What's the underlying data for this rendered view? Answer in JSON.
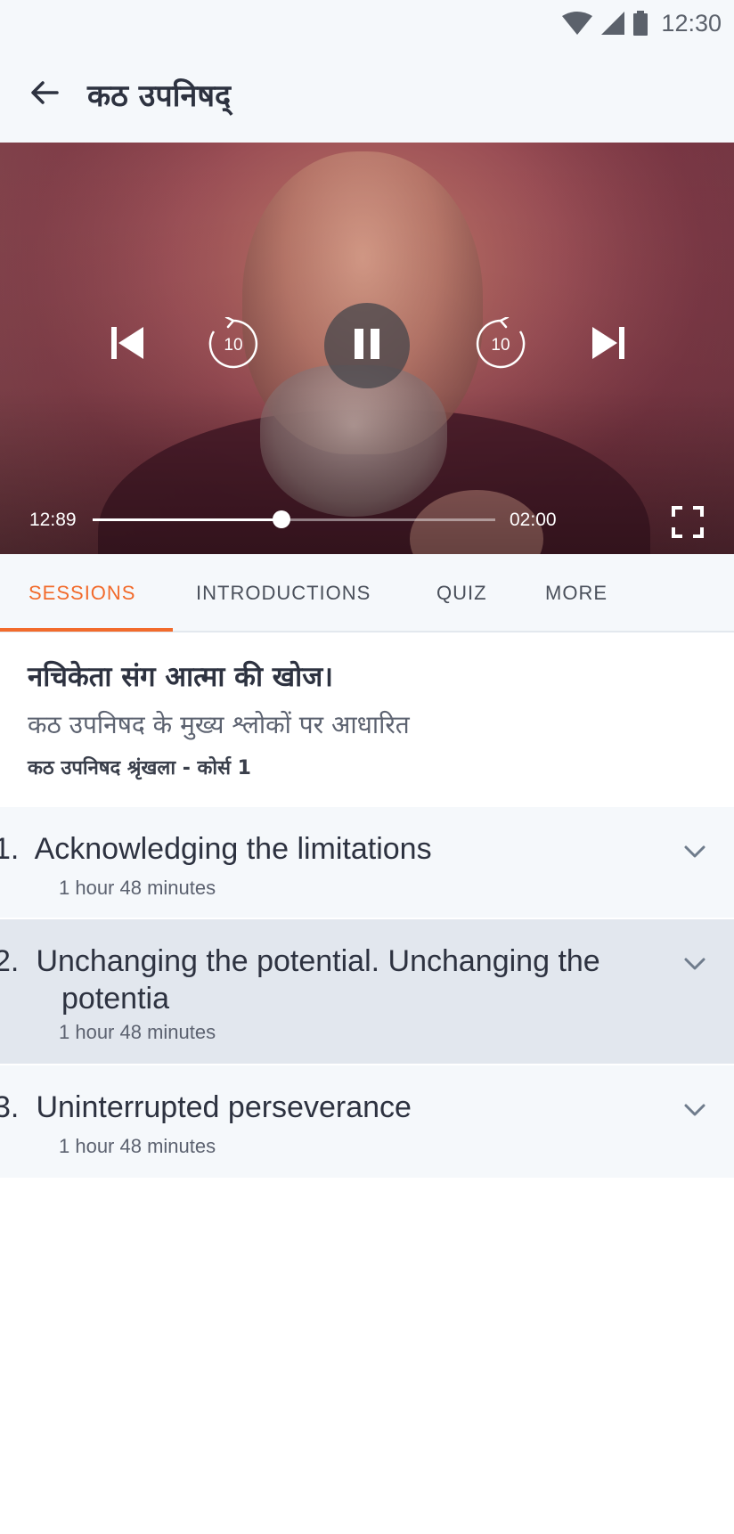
{
  "status_bar": {
    "time": "12:30",
    "icons": [
      "wifi-icon",
      "signal-icon",
      "battery-icon"
    ]
  },
  "header": {
    "title": "कठ उपनिषद्",
    "back_icon": "arrow-left-icon"
  },
  "player": {
    "current_time": "12:89",
    "duration": "02:00",
    "progress": 0.47,
    "rewind_seconds": "10",
    "forward_seconds": "10",
    "state": "playing",
    "icons": [
      "skip-previous-icon",
      "rewind-10-icon",
      "pause-icon",
      "forward-10-icon",
      "skip-next-icon",
      "fullscreen-icon"
    ]
  },
  "tabs": [
    {
      "label": "SESSIONS",
      "active": true
    },
    {
      "label": "INTRODUCTIONS",
      "active": false
    },
    {
      "label": "QUIZ",
      "active": false
    },
    {
      "label": "MORE",
      "active": false
    }
  ],
  "course": {
    "title": "नचिकेता संग आत्मा की खोज।",
    "subtitle": "कठ उपनिषद के मुख्य श्लोकों पर आधारित",
    "series": "कठ उपनिषद श्रृंखला - कोर्स 1"
  },
  "sessions": [
    {
      "number": "1.",
      "title": "Acknowledging the limitations",
      "duration": "1 hour 48 minutes",
      "selected": false
    },
    {
      "number": "2.",
      "title": "Unchanging the potential. Unchanging the potentia",
      "duration": "1 hour 48 minutes",
      "selected": true
    },
    {
      "number": "3.",
      "title": "Uninterrupted perseverance",
      "duration": "1 hour 48 minutes",
      "selected": false
    }
  ],
  "colors": {
    "accent": "#f26b2c",
    "background": "#f5f8fb",
    "selected_row": "#e2e7ee",
    "text": "#2d3240"
  }
}
